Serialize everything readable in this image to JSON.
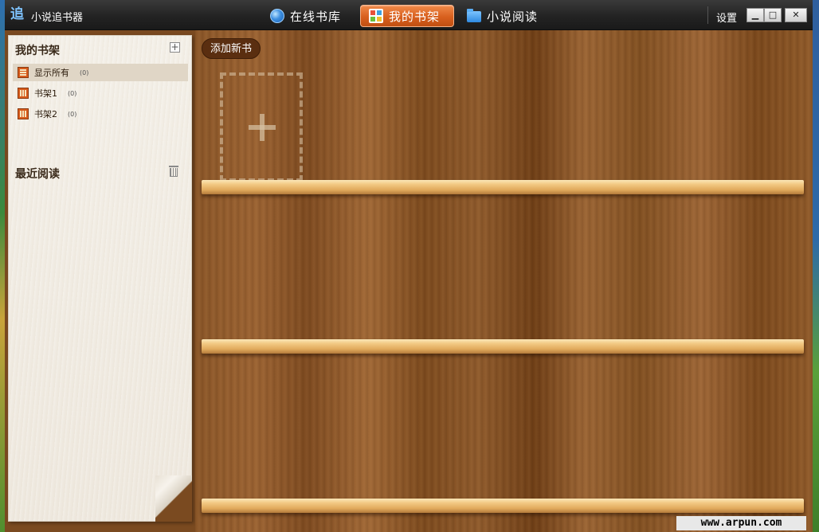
{
  "app": {
    "title": "小说追书器",
    "logo_glyph": "追"
  },
  "nav": {
    "tabs": [
      {
        "label": "在线书库",
        "icon": "globe-icon",
        "active": false
      },
      {
        "label": "我的书架",
        "icon": "bookshelf-icon",
        "active": true
      },
      {
        "label": "小说阅读",
        "icon": "folder-icon",
        "active": false
      }
    ]
  },
  "window_controls": {
    "settings_label": "设置",
    "minimize": "▁",
    "maximize": "□",
    "close": "✕"
  },
  "sidebar": {
    "bookshelf_header": "我的书架",
    "add_shelf_icon": "+",
    "shelves": [
      {
        "label": "显示所有",
        "count": "(0)",
        "active": true
      },
      {
        "label": "书架1",
        "count": "(0)",
        "active": false
      },
      {
        "label": "书架2",
        "count": "(0)",
        "active": false
      }
    ],
    "recent_header": "最近阅读"
  },
  "main": {
    "add_book_label": "添加新书"
  },
  "watermark": "www.arpun.com",
  "colors": {
    "active_tab": "#d8601e",
    "titlebar": "#232323",
    "wood": "#8a5628",
    "shelf_board": "#f2c983"
  }
}
